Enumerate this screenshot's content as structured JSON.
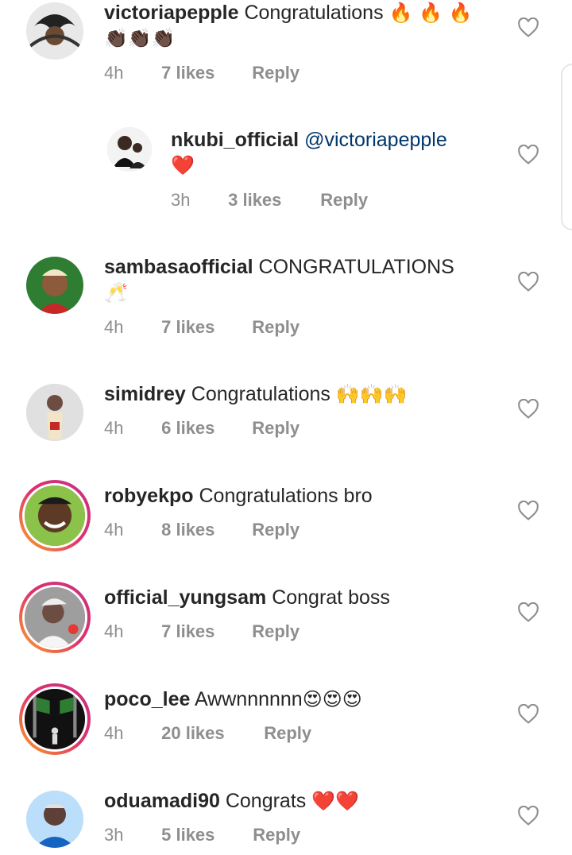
{
  "comments": [
    {
      "username": "victoriapepple",
      "text": "Congratulations ",
      "emoji": "🔥 🔥 🔥",
      "emoji2": "👏🏿👏🏿👏🏿",
      "time": "4h",
      "likes": "7 likes",
      "reply": "Reply"
    },
    {
      "username": "nkubi_official",
      "mention": "@victoriapepple",
      "emoji2": "❤️",
      "time": "3h",
      "likes": "3 likes",
      "reply": "Reply"
    },
    {
      "username": "sambasaofficial",
      "text": "CONGRATULATIONS",
      "emoji2": "🥂",
      "time": "4h",
      "likes": "7 likes",
      "reply": "Reply"
    },
    {
      "username": "simidrey",
      "text": "Congratulations ",
      "emoji": "🙌🙌🙌",
      "time": "4h",
      "likes": "6 likes",
      "reply": "Reply"
    },
    {
      "username": "robyekpo",
      "text": "Congratulations bro",
      "time": "4h",
      "likes": "8 likes",
      "reply": "Reply"
    },
    {
      "username": "official_yungsam",
      "text": "Congrat boss",
      "time": "4h",
      "likes": "7 likes",
      "reply": "Reply"
    },
    {
      "username": "poco_lee",
      "text": "Awwnnnnnn",
      "emoji": "😍😍😍",
      "time": "4h",
      "likes": "20 likes",
      "reply": "Reply"
    },
    {
      "username": "oduamadi90",
      "text": "Congrats ",
      "emoji": "❤️❤️",
      "time": "3h",
      "likes": "5 likes",
      "reply": "Reply"
    }
  ],
  "icons": {
    "like": "heart-outline-icon"
  },
  "colors": {
    "mention": "#00376b",
    "meta": "#8e8e8e",
    "story_ring": "#e1306c"
  }
}
